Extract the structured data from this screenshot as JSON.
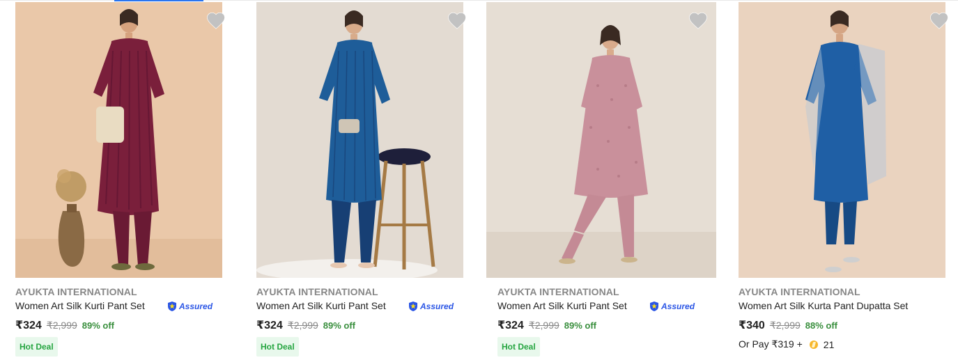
{
  "products": [
    {
      "brand": "AYUKTA INTERNATIONAL",
      "title": "Women Art Silk Kurti Pant Set",
      "assured": "Assured",
      "price": "₹324",
      "mrp": "₹2,999",
      "discount": "89% off",
      "deal_badge": "Hot Deal",
      "image_icon": "product-photo-maroon-kurti",
      "colors": {
        "bg": "#eac8a9",
        "outfit": "#7a1f3b",
        "accent": "#5a1230"
      }
    },
    {
      "brand": "AYUKTA INTERNATIONAL",
      "title": "Women Art Silk Kurti Pant Set",
      "assured": "Assured",
      "price": "₹324",
      "mrp": "₹2,999",
      "discount": "89% off",
      "deal_badge": "Hot Deal",
      "image_icon": "product-photo-blue-kurti",
      "colors": {
        "bg": "#e3dbd2",
        "outfit": "#1e5d99",
        "accent": "#173f74"
      }
    },
    {
      "brand": "AYUKTA INTERNATIONAL",
      "title": "Women Art Silk Kurti Pant Set",
      "assured": "Assured",
      "price": "₹324",
      "mrp": "₹2,999",
      "discount": "89% off",
      "deal_badge": "Hot Deal",
      "image_icon": "product-photo-pink-kurti",
      "colors": {
        "bg": "#e6ded4",
        "outfit": "#c9909b",
        "accent": "#a86c79"
      }
    },
    {
      "brand": "AYUKTA INTERNATIONAL",
      "title": "Women Art Silk Kurta Pant Dupatta Set",
      "price": "₹340",
      "mrp": "₹2,999",
      "discount": "88% off",
      "pay_with_coins": {
        "prefix": "Or Pay ₹319 +",
        "coins": "21"
      },
      "image_icon": "product-photo-blue-kurta-dupatta",
      "colors": {
        "bg": "#ead3bf",
        "outfit": "#1f5fa5",
        "accent": "#174a84"
      }
    }
  ],
  "accent_colors": {
    "price_green": "#388e3c",
    "assured_blue": "#2a55e5",
    "hot_deal_bg": "#e8f8ec"
  }
}
